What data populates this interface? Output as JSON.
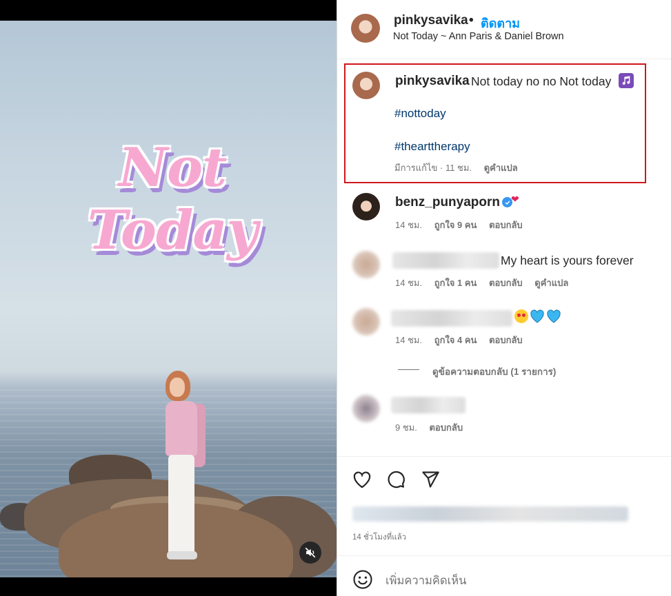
{
  "header": {
    "username": "pinkysavika",
    "separator": "•",
    "follow_label": "ติดตาม",
    "song": "Not Today ~ Ann Paris & Daniel Brown"
  },
  "media": {
    "overlay_title": "Not Today",
    "mute_icon": "speaker-muted-icon"
  },
  "caption": {
    "username": "pinkysavika",
    "text": "Not today no no Not today",
    "emoji": "music-notes-icon",
    "hashtags": [
      "#nottoday",
      "#thearttherapy"
    ],
    "edited": "มีการแก้ไข · 11 ชม.",
    "translate": "ดูคำแปล",
    "highlight_color": "#d0161b"
  },
  "comments": [
    {
      "username": "benz_punyaporn",
      "verified": true,
      "text": "",
      "time": "14 ชม.",
      "likes": "ถูกใจ 9 คน",
      "reply": "ตอบกลับ"
    },
    {
      "username": "",
      "text": "My heart is yours forever",
      "time": "14 ชม.",
      "likes": "ถูกใจ 1 คน",
      "reply": "ตอบกลับ",
      "translate": "ดูคำแปล"
    },
    {
      "username": "",
      "text": "",
      "time": "14 ชม.",
      "likes": "ถูกใจ 4 คน",
      "reply": "ตอบกลับ",
      "view_replies": "ดูข้อความตอบกลับ (1 รายการ)"
    },
    {
      "username": "",
      "text": "",
      "time": "9 ชม.",
      "reply": "ตอบกลับ"
    }
  ],
  "actions": {
    "like_icon": "heart-icon",
    "comment_icon": "comment-icon",
    "share_icon": "share-icon"
  },
  "footer": {
    "time_ago": "14 ชั่วโมงที่แล้ว",
    "comment_placeholder": "เพิ่มความคิดเห็น",
    "emoji_icon": "smiley-icon"
  },
  "colors": {
    "link": "#00376b",
    "follow": "#0095f6",
    "verified": "#3897f0",
    "secondary_text": "#737373"
  }
}
